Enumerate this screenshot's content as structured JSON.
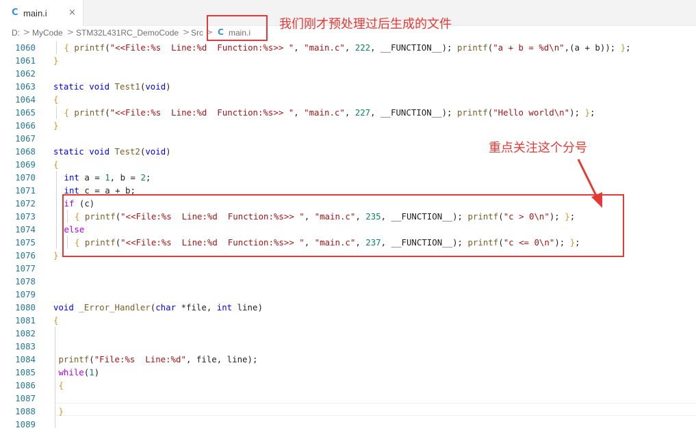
{
  "tab": {
    "icon": "c-file-icon",
    "label": "main.i",
    "close": "×"
  },
  "breadcrumb": {
    "items": [
      "D:",
      "MyCode",
      "STM32L431RC_DemoCode",
      "Src",
      "main.i"
    ],
    "separator": ">"
  },
  "annotations": {
    "file_note": "我们刚才预处理过后生成的文件",
    "semicolon_note": "重点关注这个分号",
    "color": "#e53935"
  },
  "colors": {
    "keyword": "#0000ff",
    "control": "#af00db",
    "function": "#795e26",
    "string": "#a31515",
    "number": "#098658",
    "bracket": "#c79a2b",
    "line_number": "#237893"
  },
  "code_lines": [
    {
      "n": "1060",
      "ind": 1,
      "segs": [
        [
          "{ ",
          "br"
        ],
        [
          "printf",
          "fn"
        ],
        [
          "(",
          ""
        ],
        [
          "\"<<File:%s  Line:%d  Function:%s>> \"",
          "str"
        ],
        [
          ", ",
          ""
        ],
        [
          "\"main.c\"",
          "str"
        ],
        [
          ", ",
          ""
        ],
        [
          "222",
          "num"
        ],
        [
          ", __FUNCTION__); ",
          ""
        ],
        [
          "printf",
          "fn"
        ],
        [
          "(",
          ""
        ],
        [
          "\"a + b = %d\\n\"",
          "str"
        ],
        [
          ",(a + b)); ",
          ""
        ],
        [
          "}",
          "br"
        ],
        [
          ";",
          ""
        ]
      ]
    },
    {
      "n": "1061",
      "ind": 0,
      "segs": [
        [
          "}",
          "br"
        ]
      ]
    },
    {
      "n": "1062",
      "ind": 0,
      "segs": []
    },
    {
      "n": "1063",
      "ind": 0,
      "segs": [
        [
          "static",
          "kw"
        ],
        [
          " ",
          ""
        ],
        [
          "void",
          "kw"
        ],
        [
          " ",
          ""
        ],
        [
          "Test1",
          "fn"
        ],
        [
          "(",
          ""
        ],
        [
          "void",
          "kw"
        ],
        [
          ")",
          ""
        ]
      ]
    },
    {
      "n": "1064",
      "ind": 0,
      "segs": [
        [
          "{",
          "br"
        ]
      ]
    },
    {
      "n": "1065",
      "ind": 1,
      "segs": [
        [
          "{ ",
          "br"
        ],
        [
          "printf",
          "fn"
        ],
        [
          "(",
          ""
        ],
        [
          "\"<<File:%s  Line:%d  Function:%s>> \"",
          "str"
        ],
        [
          ", ",
          ""
        ],
        [
          "\"main.c\"",
          "str"
        ],
        [
          ", ",
          ""
        ],
        [
          "227",
          "num"
        ],
        [
          ", __FUNCTION__); ",
          ""
        ],
        [
          "printf",
          "fn"
        ],
        [
          "(",
          ""
        ],
        [
          "\"Hello world\\n\"",
          "str"
        ],
        [
          "); ",
          ""
        ],
        [
          "}",
          "br"
        ],
        [
          ";",
          ""
        ]
      ]
    },
    {
      "n": "1066",
      "ind": 0,
      "segs": [
        [
          "}",
          "br"
        ]
      ]
    },
    {
      "n": "1067",
      "ind": 0,
      "segs": []
    },
    {
      "n": "1068",
      "ind": 0,
      "segs": [
        [
          "static",
          "kw"
        ],
        [
          " ",
          ""
        ],
        [
          "void",
          "kw"
        ],
        [
          " ",
          ""
        ],
        [
          "Test2",
          "fn"
        ],
        [
          "(",
          ""
        ],
        [
          "void",
          "kw"
        ],
        [
          ")",
          ""
        ]
      ]
    },
    {
      "n": "1069",
      "ind": 0,
      "segs": [
        [
          "{",
          "br"
        ]
      ]
    },
    {
      "n": "1070",
      "ind": 1,
      "segs": [
        [
          "int",
          "kw"
        ],
        [
          " a = ",
          ""
        ],
        [
          "1",
          "num"
        ],
        [
          ", b = ",
          ""
        ],
        [
          "2",
          "num"
        ],
        [
          ";",
          ""
        ]
      ]
    },
    {
      "n": "1071",
      "ind": 1,
      "segs": [
        [
          "int",
          "kw"
        ],
        [
          " c = a + b;",
          ""
        ]
      ]
    },
    {
      "n": "1072",
      "ind": 1,
      "segs": [
        [
          "if",
          "ctl"
        ],
        [
          " (c)",
          ""
        ]
      ]
    },
    {
      "n": "1073",
      "ind": 2,
      "segs": [
        [
          "{ ",
          "br"
        ],
        [
          "printf",
          "fn"
        ],
        [
          "(",
          ""
        ],
        [
          "\"<<File:%s  Line:%d  Function:%s>> \"",
          "str"
        ],
        [
          ", ",
          ""
        ],
        [
          "\"main.c\"",
          "str"
        ],
        [
          ", ",
          ""
        ],
        [
          "235",
          "num"
        ],
        [
          ", __FUNCTION__); ",
          ""
        ],
        [
          "printf",
          "fn"
        ],
        [
          "(",
          ""
        ],
        [
          "\"c > 0\\n\"",
          "str"
        ],
        [
          "); ",
          ""
        ],
        [
          "}",
          "br"
        ],
        [
          ";",
          ""
        ]
      ]
    },
    {
      "n": "1074",
      "ind": 1,
      "segs": [
        [
          "else",
          "ctl"
        ]
      ]
    },
    {
      "n": "1075",
      "ind": 2,
      "segs": [
        [
          "{ ",
          "br"
        ],
        [
          "printf",
          "fn"
        ],
        [
          "(",
          ""
        ],
        [
          "\"<<File:%s  Line:%d  Function:%s>> \"",
          "str"
        ],
        [
          ", ",
          ""
        ],
        [
          "\"main.c\"",
          "str"
        ],
        [
          ", ",
          ""
        ],
        [
          "237",
          "num"
        ],
        [
          ", __FUNCTION__); ",
          ""
        ],
        [
          "printf",
          "fn"
        ],
        [
          "(",
          ""
        ],
        [
          "\"c <= 0\\n\"",
          "str"
        ],
        [
          "); ",
          ""
        ],
        [
          "}",
          "br"
        ],
        [
          ";",
          ""
        ]
      ]
    },
    {
      "n": "1076",
      "ind": 0,
      "segs": [
        [
          "}",
          "br"
        ]
      ]
    },
    {
      "n": "1077",
      "ind": 0,
      "segs": []
    },
    {
      "n": "1078",
      "ind": 0,
      "segs": []
    },
    {
      "n": "1079",
      "ind": 0,
      "segs": []
    },
    {
      "n": "1080",
      "ind": 0,
      "segs": [
        [
          "void",
          "kw"
        ],
        [
          " ",
          ""
        ],
        [
          "_Error_Handler",
          "fn"
        ],
        [
          "(",
          ""
        ],
        [
          "char",
          "kw"
        ],
        [
          " *file, ",
          ""
        ],
        [
          "int",
          "kw"
        ],
        [
          " line)",
          ""
        ]
      ]
    },
    {
      "n": "1081",
      "ind": 0,
      "segs": [
        [
          "{",
          "br"
        ]
      ]
    },
    {
      "n": "1082",
      "ind": 0,
      "segs": []
    },
    {
      "n": "1083",
      "ind": 0,
      "segs": []
    },
    {
      "n": "1084",
      "ind": 0,
      "segs": [
        [
          " ",
          ""
        ],
        [
          "printf",
          "fn"
        ],
        [
          "(",
          ""
        ],
        [
          "\"File:%s  Line:%d\"",
          "str"
        ],
        [
          ", file, line);",
          ""
        ]
      ]
    },
    {
      "n": "1085",
      "ind": 0,
      "segs": [
        [
          " ",
          ""
        ],
        [
          "while",
          "ctl"
        ],
        [
          "(",
          ""
        ],
        [
          "1",
          "num"
        ],
        [
          ")",
          ""
        ]
      ]
    },
    {
      "n": "1086",
      "ind": 0,
      "segs": [
        [
          " ",
          ""
        ],
        [
          "{",
          "br"
        ]
      ]
    },
    {
      "n": "1087",
      "ind": 0,
      "segs": []
    },
    {
      "n": "1088",
      "ind": 0,
      "segs": [
        [
          " ",
          ""
        ],
        [
          "}",
          "br"
        ]
      ]
    },
    {
      "n": "1089",
      "ind": 0,
      "segs": []
    }
  ]
}
